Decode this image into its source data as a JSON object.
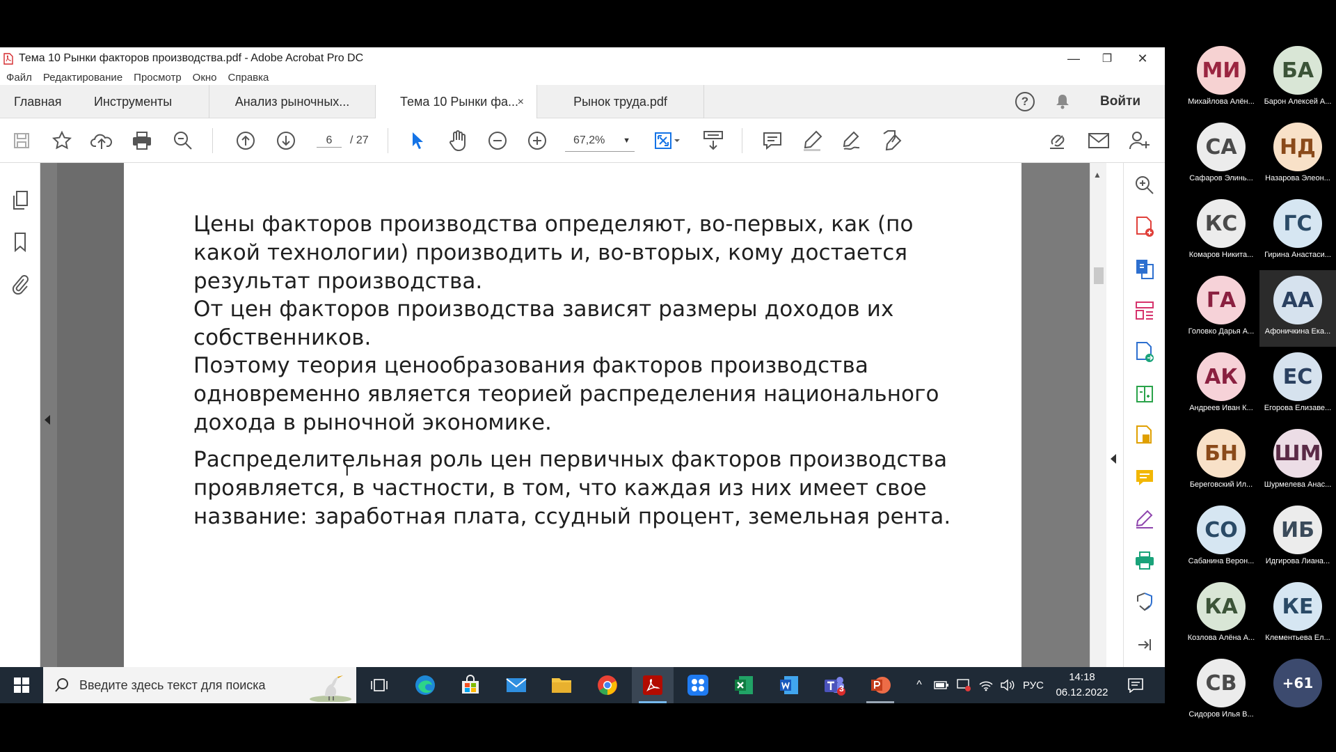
{
  "window": {
    "title": "Тема 10 Рынки факторов производства.pdf - Adobe Acrobat Pro DC",
    "minimize": "—",
    "restore": "❐",
    "close": "✕"
  },
  "menu": [
    "Файл",
    "Редактирование",
    "Просмотр",
    "Окно",
    "Справка"
  ],
  "tabs": {
    "home": "Главная",
    "tools": "Инструменты",
    "docs": [
      {
        "label": "Анализ рыночных..."
      },
      {
        "label": "Тема 10 Рынки фа...",
        "close": "×",
        "active": true
      },
      {
        "label": "Рынок труда.pdf"
      }
    ],
    "help": "?",
    "signin": "Войти"
  },
  "toolbar": {
    "page_current": "6",
    "page_total": "/ 27",
    "zoom": "67,2%",
    "zoom_arrow": "▼"
  },
  "document": {
    "paragraphs": [
      "Цены факторов производства определяют, во-первых, как (по какой технологии) производить и, во-вторых, кому достается результат производства.",
      "От цен факторов производства зависят размеры доходов их собственников.",
      "Поэтому теория ценообразования факторов производства одновременно является теорией распределения национального дохода в рыночной экономике.",
      "Распределительная роль цен первичных факторов производства проявляется, в частности, в том, что каждая из них имеет свое название: заработная плата, ссудный процент, земельная рента."
    ]
  },
  "taskbar": {
    "search_placeholder": "Введите здесь текст для поиска",
    "lang": "РУС",
    "time": "14:18",
    "date": "06.12.2022",
    "teams_badge": "3",
    "tray_chevron": "^"
  },
  "participants": [
    {
      "initials": "МИ",
      "name": "Михайлова Алён...",
      "bg": "#f6d2d2",
      "fg": "#9a2540"
    },
    {
      "initials": "БА",
      "name": "Барон Алексей А...",
      "bg": "#d9e6d6",
      "fg": "#3c5438"
    },
    {
      "initials": "СА",
      "name": "Сафаров Элинь...",
      "bg": "#ececec",
      "fg": "#4a4a4a"
    },
    {
      "initials": "НД",
      "name": "Назарова Элеон...",
      "bg": "#f8e1c8",
      "fg": "#8a4a1a"
    },
    {
      "initials": "КС",
      "name": "Комаров Никита...",
      "bg": "#ececec",
      "fg": "#4a4a4a"
    },
    {
      "initials": "ГС",
      "name": "Гирина Анастаси...",
      "bg": "#d6e6f2",
      "fg": "#2a4a66"
    },
    {
      "initials": "ГА",
      "name": "Головко Дарья А...",
      "bg": "#f6d2d8",
      "fg": "#8a2040"
    },
    {
      "initials": "АА",
      "name": "Афоничкина Ека...",
      "bg": "#d6e2ee",
      "fg": "#2a4060",
      "highlight": true
    },
    {
      "initials": "АК",
      "name": "Андреев Иван К...",
      "bg": "#f6d2d8",
      "fg": "#8a2040"
    },
    {
      "initials": "ЕС",
      "name": "Егорова Елизаве...",
      "bg": "#d6e2ee",
      "fg": "#2a4060"
    },
    {
      "initials": "БН",
      "name": "Береговский Ил...",
      "bg": "#f8e1c8",
      "fg": "#8a4a1a"
    },
    {
      "initials": "ШМ",
      "name": "Шурмелева Анас...",
      "bg": "#ecdde6",
      "fg": "#5a2a46"
    },
    {
      "initials": "СО",
      "name": "Сабанина Верон...",
      "bg": "#d6e6f2",
      "fg": "#2a4a66"
    },
    {
      "initials": "ИБ",
      "name": "Идгирова Лиана...",
      "bg": "#ececec",
      "fg": "#3a4a5a"
    },
    {
      "initials": "КА",
      "name": "Козлова Алёна А...",
      "bg": "#d9e6d6",
      "fg": "#3c5438"
    },
    {
      "initials": "КЕ",
      "name": "Клементьева Ел...",
      "bg": "#d6e6f2",
      "fg": "#2a4a66"
    },
    {
      "initials": "СВ",
      "name": "Сидоров Илья В...",
      "bg": "#ececec",
      "fg": "#4a4a4a"
    },
    {
      "initials": "+61",
      "name": "",
      "bg": "#3c4a6e",
      "fg": "#ffffff"
    }
  ],
  "colors": {
    "doc_bg": "#7b7b7b",
    "taskbar": "#1f2a36",
    "accent_blue": "#1473e6"
  }
}
